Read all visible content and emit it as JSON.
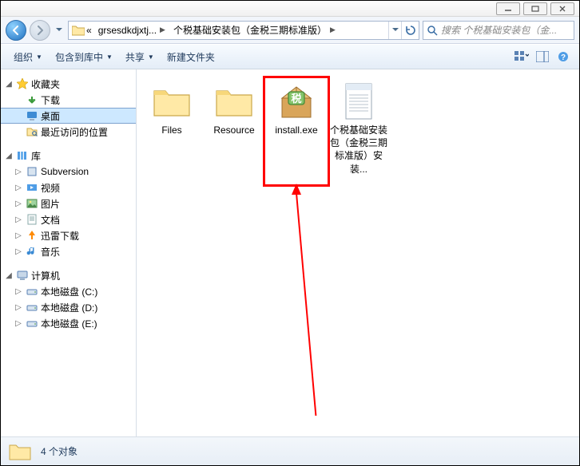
{
  "titlebar": {},
  "address": {
    "crumbs": [
      "«",
      "grsesdkdjxtj...",
      "个税基础安装包（金税三期标准版）"
    ]
  },
  "search": {
    "placeholder_display": "搜索 个税基础安装包（金..."
  },
  "toolbar": {
    "organize": "组织",
    "include": "包含到库中",
    "share": "共享",
    "newfolder": "新建文件夹"
  },
  "tree": {
    "favorites": {
      "label": "收藏夹",
      "items": [
        "下载",
        "桌面",
        "最近访问的位置"
      ],
      "selected_index": 1
    },
    "libraries": {
      "label": "库",
      "items": [
        "Subversion",
        "视频",
        "图片",
        "文档",
        "迅雷下载",
        "音乐"
      ]
    },
    "computer": {
      "label": "计算机",
      "items": [
        "本地磁盘 (C:)",
        "本地磁盘 (D:)",
        "本地磁盘 (E:)"
      ]
    }
  },
  "files": {
    "items": [
      {
        "name": "Files",
        "kind": "folder"
      },
      {
        "name": "Resource",
        "kind": "folder"
      },
      {
        "name": "install.exe",
        "kind": "installer"
      },
      {
        "name": "个税基础安装包（金税三期标准版）安装...",
        "kind": "textfile"
      }
    ],
    "highlight_index": 2
  },
  "status": {
    "text": "4 个对象"
  }
}
